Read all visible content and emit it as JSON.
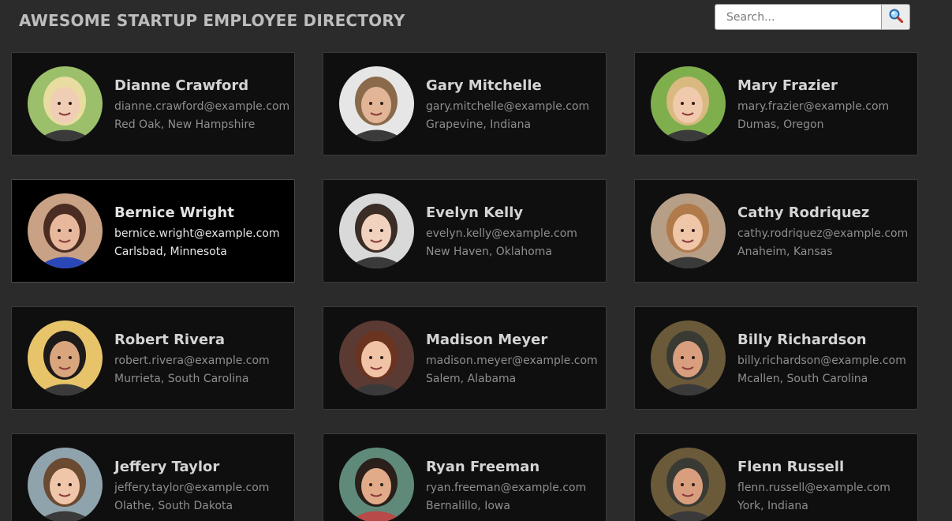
{
  "header": {
    "title": "AWESOME STARTUP EMPLOYEE DIRECTORY"
  },
  "search": {
    "placeholder": "Search...",
    "value": "",
    "button_icon": "magnifier-icon"
  },
  "employees": [
    {
      "name": "Dianne Crawford",
      "email": "dianne.crawford@example.com",
      "location": "Red Oak, New Hampshire",
      "bg": "#9bbf6a",
      "skin": "#f0cdb5",
      "hair": "#e9dca0"
    },
    {
      "name": "Gary Mitchelle",
      "email": "gary.mitchelle@example.com",
      "location": "Grapevine, Indiana",
      "bg": "#e6e6e6",
      "skin": "#e2b596",
      "hair": "#8a6a4a"
    },
    {
      "name": "Mary Frazier",
      "email": "mary.frazier@example.com",
      "location": "Dumas, Oregon",
      "bg": "#7fae4d",
      "skin": "#f1c9ac",
      "hair": "#d9b980"
    },
    {
      "name": "Bernice Wright",
      "email": "bernice.wright@example.com",
      "location": "Carlsbad, Minnesota",
      "bg": "#c9a184",
      "skin": "#e7b89c",
      "hair": "#4a2c22",
      "shirt": "#2a47b8"
    },
    {
      "name": "Evelyn Kelly",
      "email": "evelyn.kelly@example.com",
      "location": "New Haven, Oklahoma",
      "bg": "#d9d9d9",
      "skin": "#f0d2be",
      "hair": "#3a2d26"
    },
    {
      "name": "Cathy Rodriquez",
      "email": "cathy.rodriquez@example.com",
      "location": "Anaheim, Kansas",
      "bg": "#b79e86",
      "skin": "#efc6a8",
      "hair": "#b07a4a"
    },
    {
      "name": "Robert Rivera",
      "email": "robert.rivera@example.com",
      "location": "Murrieta, South Carolina",
      "bg": "#e7c46a",
      "skin": "#d9a57d",
      "hair": "#1d1a1a"
    },
    {
      "name": "Madison Meyer",
      "email": "madison.meyer@example.com",
      "location": "Salem, Alabama",
      "bg": "#5a3a32",
      "skin": "#f0c2a6",
      "hair": "#6a3420"
    },
    {
      "name": "Billy Richardson",
      "email": "billy.richardson@example.com",
      "location": "Mcallen, South Carolina",
      "bg": "#6a5a3a",
      "skin": "#d99e7e",
      "hair": "#3a3a35"
    },
    {
      "name": "Jeffery Taylor",
      "email": "jeffery.taylor@example.com",
      "location": "Olathe, South Dakota",
      "bg": "#8fa3ad",
      "skin": "#f0c6ab",
      "hair": "#6a4a30"
    },
    {
      "name": "Ryan Freeman",
      "email": "ryan.freeman@example.com",
      "location": "Bernalillo, Iowa",
      "bg": "#5f8a7a",
      "skin": "#e1ab8a",
      "hair": "#2a1f1a",
      "shirt": "#b84a4a"
    },
    {
      "name": "Flenn Russell",
      "email": "flenn.russell@example.com",
      "location": "York, Indiana",
      "bg": "#6a5a3a",
      "skin": "#d99e7e",
      "hair": "#3a3a35"
    }
  ],
  "active_index": 3
}
